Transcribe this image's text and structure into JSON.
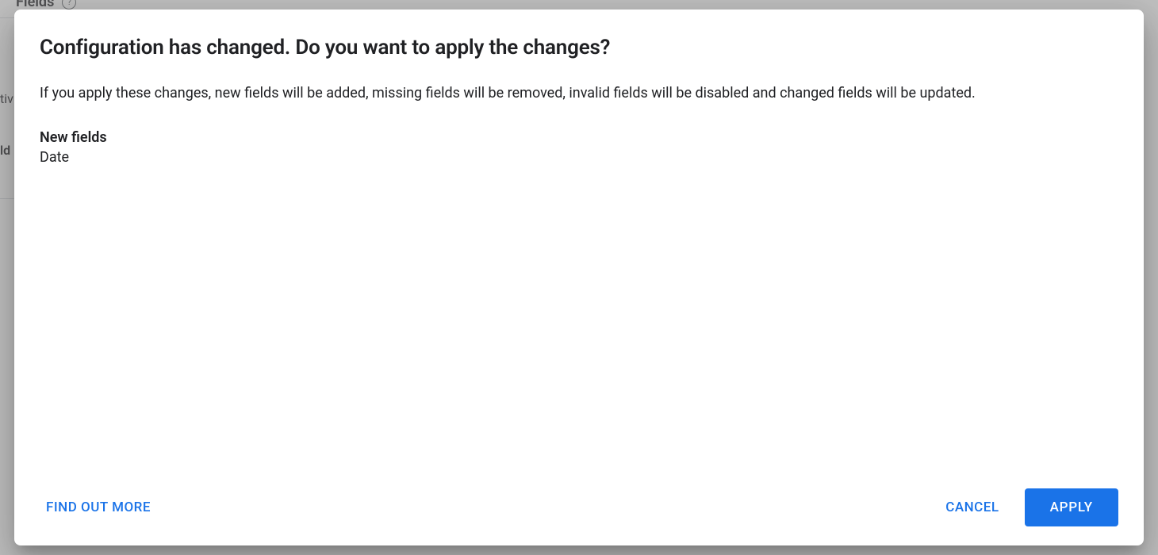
{
  "background": {
    "header_label": "Fields",
    "row1_text": "tiv",
    "row2_text": "ld"
  },
  "modal": {
    "title": "Configuration has changed. Do you want to apply the changes?",
    "description": "If you apply these changes, new fields will be added, missing fields will be removed, invalid fields will be disabled and changed fields will be updated.",
    "sections": {
      "new_fields": {
        "label": "New fields",
        "items": [
          "Date"
        ]
      }
    },
    "footer": {
      "find_out_more": "FIND OUT MORE",
      "cancel": "CANCEL",
      "apply": "APPLY"
    }
  }
}
